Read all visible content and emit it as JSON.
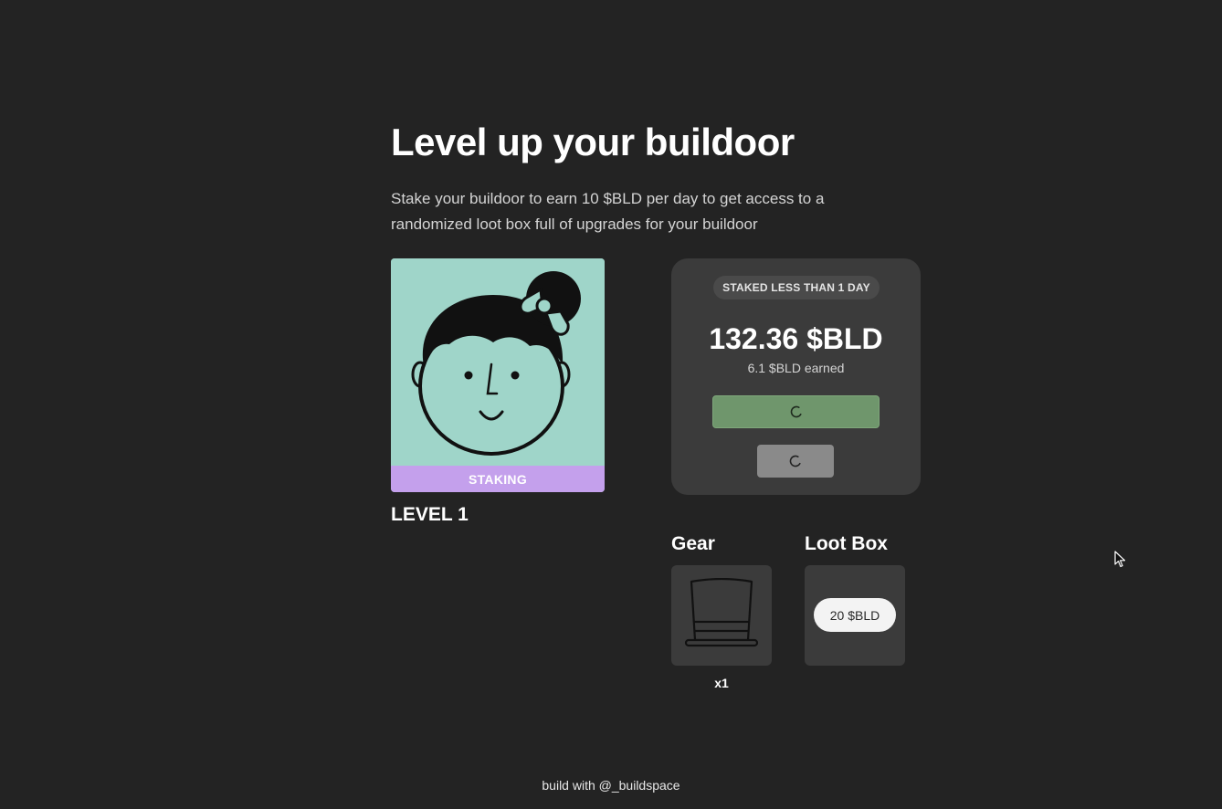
{
  "header": {
    "title": "Level up your buildoor",
    "description": "Stake your buildoor to earn 10 $BLD per day to get access to a randomized loot box full of upgrades for your buildoor"
  },
  "nft": {
    "status_label": "STAKING",
    "level_label": "LEVEL 1",
    "colors": {
      "background": "#9fd5c9",
      "status_bar": "#c4a0ec"
    }
  },
  "stake_panel": {
    "badge": "STAKED LESS THAN 1 DAY",
    "balance": "132.36 $BLD",
    "earned": "6.1 $BLD earned",
    "claim_button": {
      "state": "loading",
      "icon": "spinner-icon",
      "color": "#6f966c"
    },
    "unstake_button": {
      "state": "loading",
      "icon": "spinner-icon",
      "color": "#8a8a8a"
    }
  },
  "gear": {
    "title": "Gear",
    "items": [
      {
        "icon": "top-hat-icon",
        "count_label": "x1"
      }
    ]
  },
  "loot_box": {
    "title": "Loot Box",
    "price_label": "20 $BLD"
  },
  "footer": {
    "text": "build with @_buildspace"
  }
}
